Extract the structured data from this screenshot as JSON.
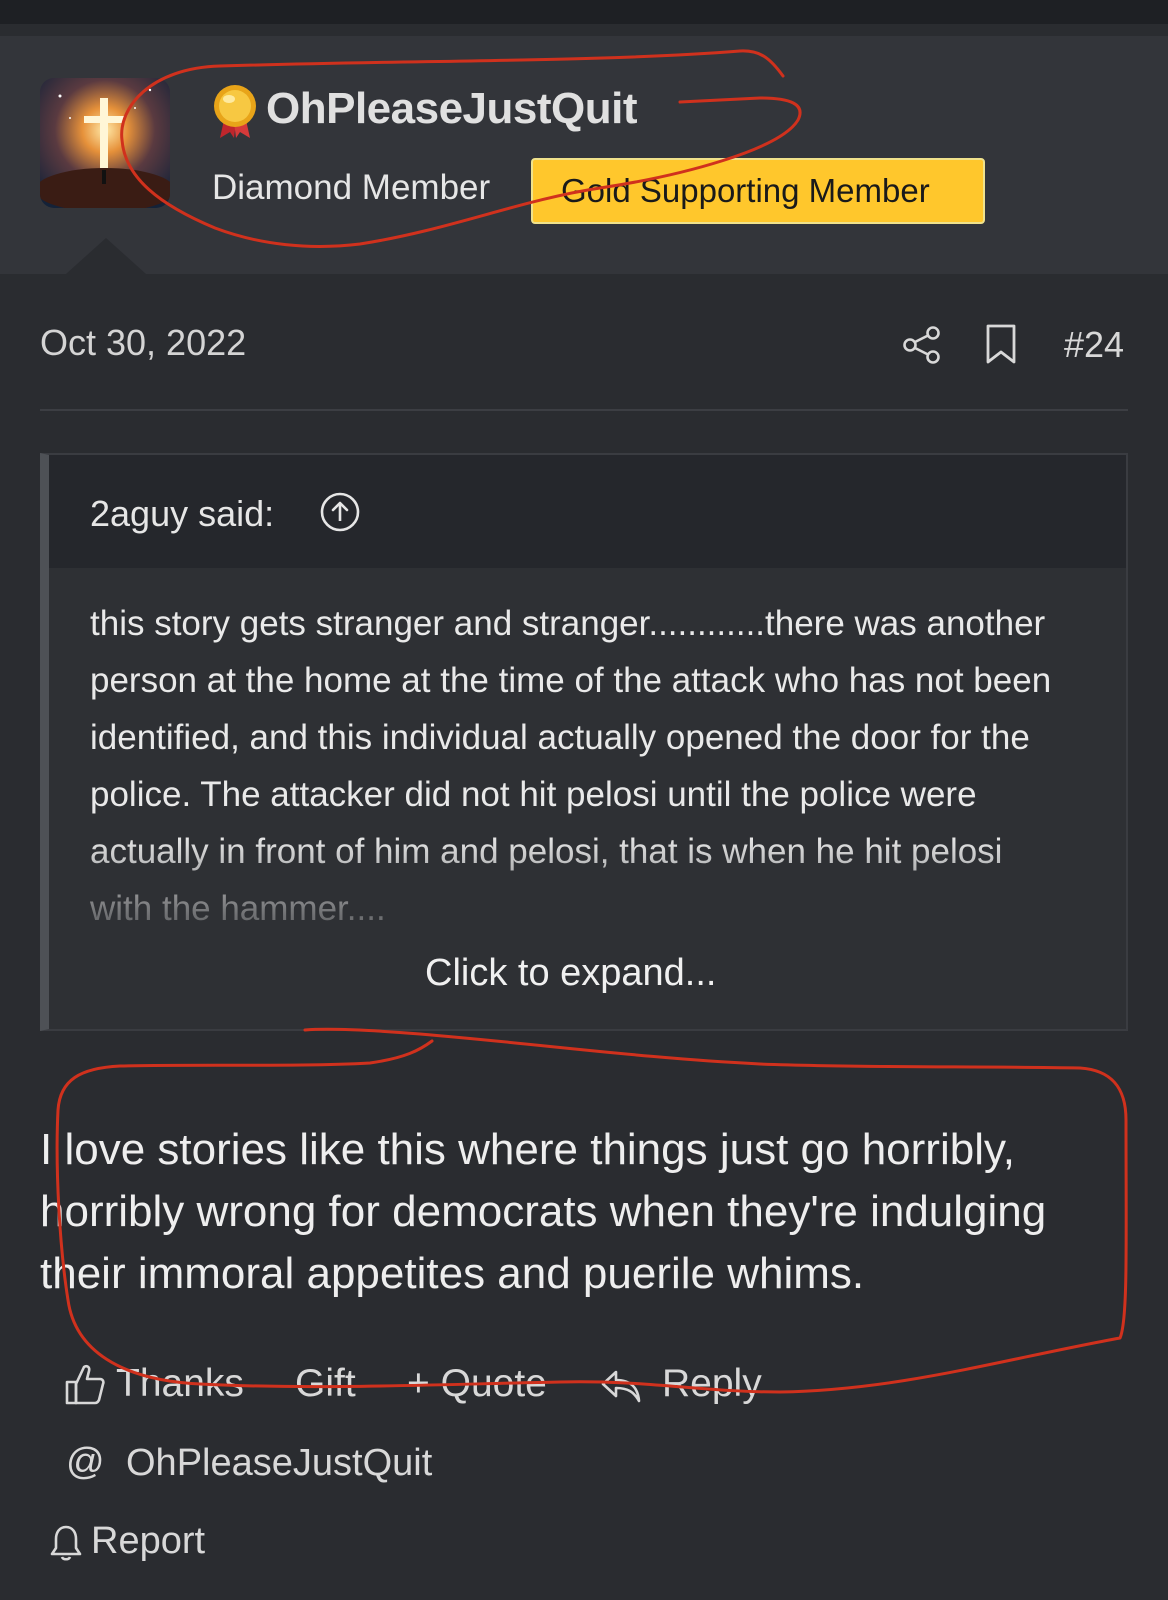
{
  "post": {
    "author": {
      "username": "OhPleaseJustQuit",
      "title": "Diamond Member",
      "badge": "Gold Supporting Member",
      "avatar": "avatar-cross-sky",
      "medal_icon": "gold-medal-icon"
    },
    "date": "Oct 30, 2022",
    "number": "#24",
    "icons": {
      "share": "share-icon",
      "bookmark": "bookmark-icon"
    },
    "quote": {
      "author_label": "2aguy said:",
      "body": "this story gets stranger and stranger............there was another person at the home at the time of the attack who has not been identified, and this individual actually opened the door for the police. The attacker did not hit pelosi until the police were actually in front of him and pelosi, that is when he hit pelosi with the hammer....",
      "expand_label": "Click to expand..."
    },
    "message": "I love stories like this where things just go horribly, horribly wrong for democrats when they're indulging their immoral appetites and puerile whims."
  },
  "actions": {
    "thanks_label": "Thanks",
    "gift_label": "Gift",
    "quote_label": "+ Quote",
    "reply_label": "Reply",
    "mention_symbol": "@",
    "mention_name": "OhPleaseJustQuit",
    "report_label": "Report"
  },
  "colors": {
    "background": "#2a2c30",
    "header_band": "#33353a",
    "badge": "#ffc72c",
    "annotation_stroke": "#d0311d"
  }
}
